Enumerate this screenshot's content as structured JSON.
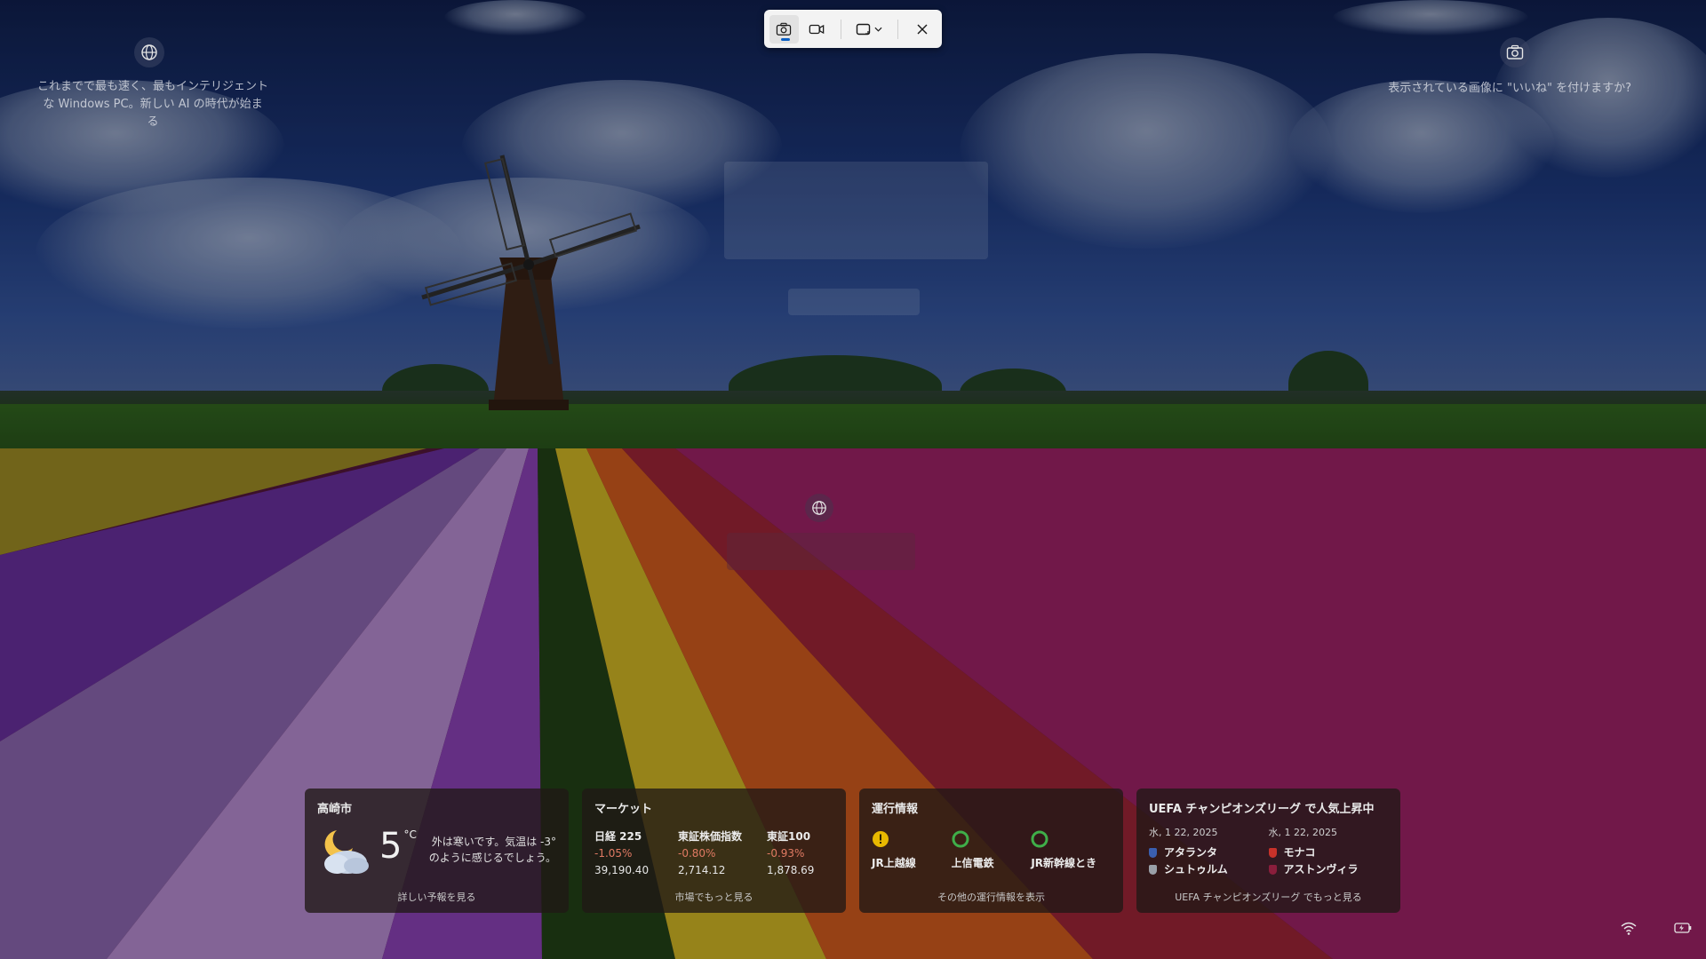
{
  "snip_toolbar": {
    "icons": [
      "camera-icon",
      "video-icon",
      "rectangle-select-icon",
      "chevron-down-icon",
      "close-icon"
    ]
  },
  "spotlight": {
    "tagline": "これまでで最も速く、最もインテリジェントな Windows PC。新しい AI の時代が始まる",
    "like_prompt": "表示されている画像に \"いいね\" を付けますか?"
  },
  "widgets": {
    "weather": {
      "title": "高崎市",
      "temp": "5",
      "unit": "°C",
      "description": "外は寒いです。気温は -3° のように感じるでしょう。",
      "footer": "詳しい予報を見る"
    },
    "market": {
      "title": "マーケット",
      "items": [
        {
          "name": "日経 225",
          "change": "-1.05%",
          "value": "39,190.40"
        },
        {
          "name": "東証株価指数",
          "change": "-0.80%",
          "value": "2,714.12"
        },
        {
          "name": "東証100",
          "change": "-0.93%",
          "value": "1,878.69"
        }
      ],
      "footer": "市場でもっと見る"
    },
    "transit": {
      "title": "運行情報",
      "lines": [
        {
          "name": "JR上越線",
          "status": "warning",
          "color": "#e8b800"
        },
        {
          "name": "上信電鉄",
          "status": "ok",
          "color": "#3fae49"
        },
        {
          "name": "JR新幹線とき",
          "status": "ok",
          "color": "#3fae49"
        }
      ],
      "footer": "その他の運行情報を表示"
    },
    "soccer": {
      "title": "UEFA チャンピオンズリーグ で人気上昇中",
      "matches": [
        {
          "date": "水, 1 22, 2025",
          "team1": "アタランタ",
          "team2": "シュトゥルム"
        },
        {
          "date": "水, 1 22, 2025",
          "team1": "モナコ",
          "team2": "アストンヴィラ"
        }
      ],
      "footer": "UEFA チャンピオンズリーグ でもっと見る"
    }
  },
  "colors": {
    "accent": "#0a5fc4",
    "market_negative": "#e07a63"
  }
}
